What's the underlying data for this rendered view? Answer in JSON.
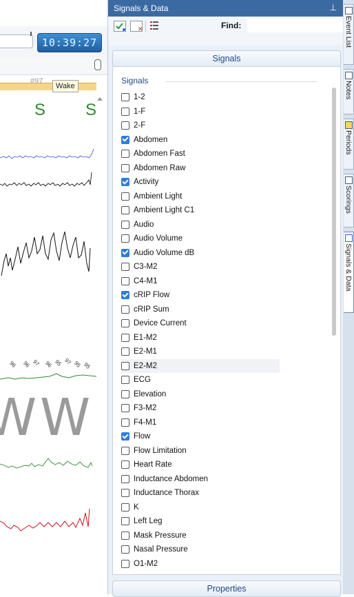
{
  "timebar": {
    "clock": "10:39:27"
  },
  "hypnogram": {
    "mark": "#97",
    "tag": "Wake"
  },
  "chart_stage_labels": {
    "s1": "S",
    "s2": "S",
    "w1": "W",
    "w2": "W"
  },
  "oxygen_values": [
    "96",
    "96",
    "97",
    "96",
    "95",
    "97",
    "95",
    "95"
  ],
  "panel": {
    "title": "Signals & Data",
    "pin": "ᵖ",
    "find_label": "Find:",
    "signals_header": "Signals",
    "group_label": "Signals",
    "properties_header": "Properties"
  },
  "signals": [
    {
      "label": "1-2",
      "checked": false
    },
    {
      "label": "1-F",
      "checked": false
    },
    {
      "label": "2-F",
      "checked": false
    },
    {
      "label": "Abdomen",
      "checked": true
    },
    {
      "label": "Abdomen Fast",
      "checked": false
    },
    {
      "label": "Abdomen Raw",
      "checked": false
    },
    {
      "label": "Activity",
      "checked": true
    },
    {
      "label": "Ambient Light",
      "checked": false
    },
    {
      "label": "Ambient Light C1",
      "checked": false
    },
    {
      "label": "Audio",
      "checked": false
    },
    {
      "label": "Audio Volume",
      "checked": false
    },
    {
      "label": "Audio Volume dB",
      "checked": true
    },
    {
      "label": "C3-M2",
      "checked": false
    },
    {
      "label": "C4-M1",
      "checked": false
    },
    {
      "label": "cRIP Flow",
      "checked": true
    },
    {
      "label": "cRIP Sum",
      "checked": false
    },
    {
      "label": "Device Current",
      "checked": false
    },
    {
      "label": "E1-M2",
      "checked": false
    },
    {
      "label": "E2-M1",
      "checked": false
    },
    {
      "label": "E2-M2",
      "checked": false
    },
    {
      "label": "ECG",
      "checked": false
    },
    {
      "label": "Elevation",
      "checked": false
    },
    {
      "label": "F3-M2",
      "checked": false
    },
    {
      "label": "F4-M1",
      "checked": false
    },
    {
      "label": "Flow",
      "checked": true
    },
    {
      "label": "Flow Limitation",
      "checked": false
    },
    {
      "label": "Heart Rate",
      "checked": false
    },
    {
      "label": "Inductance Abdomen",
      "checked": false
    },
    {
      "label": "Inductance Thorax",
      "checked": false
    },
    {
      "label": "K",
      "checked": false
    },
    {
      "label": "Left Leg",
      "checked": false
    },
    {
      "label": "Mask Pressure",
      "checked": false
    },
    {
      "label": "Nasal Pressure",
      "checked": false
    },
    {
      "label": "O1-M2",
      "checked": false
    }
  ],
  "side_tabs": [
    {
      "label": "Event List",
      "active": false
    },
    {
      "label": "Notes",
      "active": false
    },
    {
      "label": "Periods",
      "active": false
    },
    {
      "label": "Scorings",
      "active": false
    },
    {
      "label": "Signals & Data",
      "active": true
    }
  ],
  "colors": {
    "titlebar": "#3b6aa3",
    "accent": "#2f7dd8",
    "trace_green": "#2d8a2d",
    "trace_red": "#cc1111",
    "trace_blue": "#3a4fd6"
  }
}
